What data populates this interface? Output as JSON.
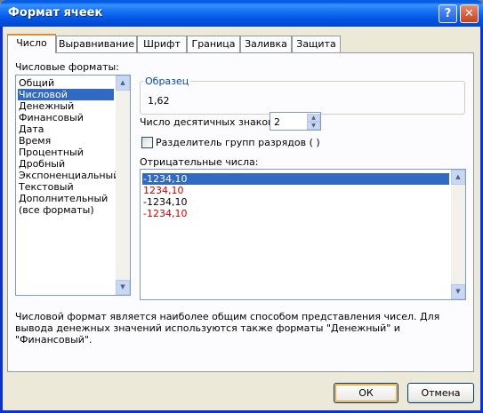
{
  "window": {
    "title": "Формат ячеек",
    "help_glyph": "?",
    "close_glyph": "✕"
  },
  "tabs": [
    {
      "label": "Число",
      "active": true
    },
    {
      "label": "Выравнивание"
    },
    {
      "label": "Шрифт"
    },
    {
      "label": "Граница"
    },
    {
      "label": "Заливка"
    },
    {
      "label": "Защита"
    }
  ],
  "formats": {
    "label": "Числовые форматы:",
    "items": [
      "Общий",
      "Числовой",
      "Денежный",
      "Финансовый",
      "Дата",
      "Время",
      "Процентный",
      "Дробный",
      "Экспоненциальный",
      "Текстовый",
      "Дополнительный",
      "(все форматы)"
    ],
    "selected_index": 1
  },
  "sample": {
    "title": "Образец",
    "value": "1,62"
  },
  "decimals": {
    "label": "Число десятичных знаков:",
    "value": "2"
  },
  "separator": {
    "label": "Разделитель групп разрядов ( )",
    "checked": false
  },
  "negative": {
    "label": "Отрицательные числа:",
    "items": [
      {
        "text": "-1234,10",
        "color": "#000000",
        "selected": true
      },
      {
        "text": "1234,10",
        "color": "#d00000"
      },
      {
        "text": "-1234,10",
        "color": "#000000"
      },
      {
        "text": "-1234,10",
        "color": "#d00000"
      }
    ]
  },
  "description": "Числовой формат является наиболее общим способом представления чисел. Для вывода денежных значений используются также форматы \"Денежный\" и \"Финансовый\".",
  "buttons": {
    "ok": "ОК",
    "cancel": "Отмена"
  },
  "colors": {
    "accent": "#316ac5",
    "title_bar": "#0058ee",
    "group_title": "#0046d5",
    "negative_red": "#d00000"
  },
  "icons": {
    "scroll_up": "arrow-up-icon",
    "scroll_down": "arrow-down-icon"
  }
}
